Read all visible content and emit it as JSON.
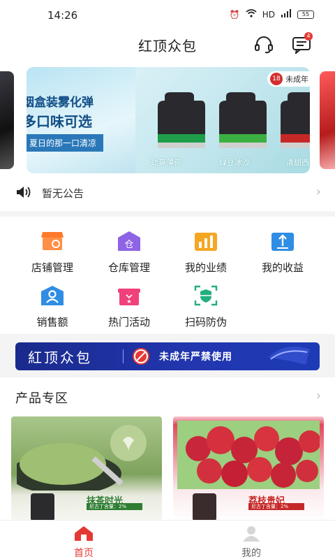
{
  "status": {
    "time": "14:26",
    "net": "HD",
    "battery": "55"
  },
  "header": {
    "title": "红顶众包",
    "badge": "4"
  },
  "banner": {
    "line1": "烟盒装雾化弹",
    "line2": "多口味可选",
    "tag": "夏日的那一口清凉",
    "age_badge": "18",
    "age_text": "未成年",
    "pods": [
      "劲爽薄荷",
      "绿豆冰沙",
      "清甜西"
    ]
  },
  "notice": {
    "text": "暂无公告"
  },
  "menu": {
    "items": [
      {
        "label": "店铺管理",
        "icon": "store-icon"
      },
      {
        "label": "仓库管理",
        "icon": "warehouse-icon"
      },
      {
        "label": "我的业绩",
        "icon": "performance-chart-icon"
      },
      {
        "label": "我的收益",
        "icon": "earnings-icon"
      },
      {
        "label": "销售额",
        "icon": "sales-user-icon"
      },
      {
        "label": "热门活动",
        "icon": "gift-icon"
      },
      {
        "label": "扫码防伪",
        "icon": "scan-shield-icon"
      }
    ],
    "colors": {
      "orange": "#ff7a2b",
      "purple": "#8e63e6",
      "gold": "#f5a623",
      "blue": "#2f8de4",
      "pink": "#f0417a",
      "green": "#22b07d"
    }
  },
  "promo": {
    "brand": "紅顶众包",
    "text": "未成年严禁使用"
  },
  "products": {
    "title": "产品专区",
    "cards": [
      {
        "name": "抹茶时光",
        "tag": "尼古丁含量：2%",
        "color": "#2e7d32"
      },
      {
        "name": "荔枝贵妃",
        "tag": "尼古丁含量：2%",
        "color": "#c62828"
      }
    ]
  },
  "tabs": [
    {
      "label": "首页",
      "active": true
    },
    {
      "label": "我的",
      "active": false
    }
  ],
  "accent": "#e53935"
}
